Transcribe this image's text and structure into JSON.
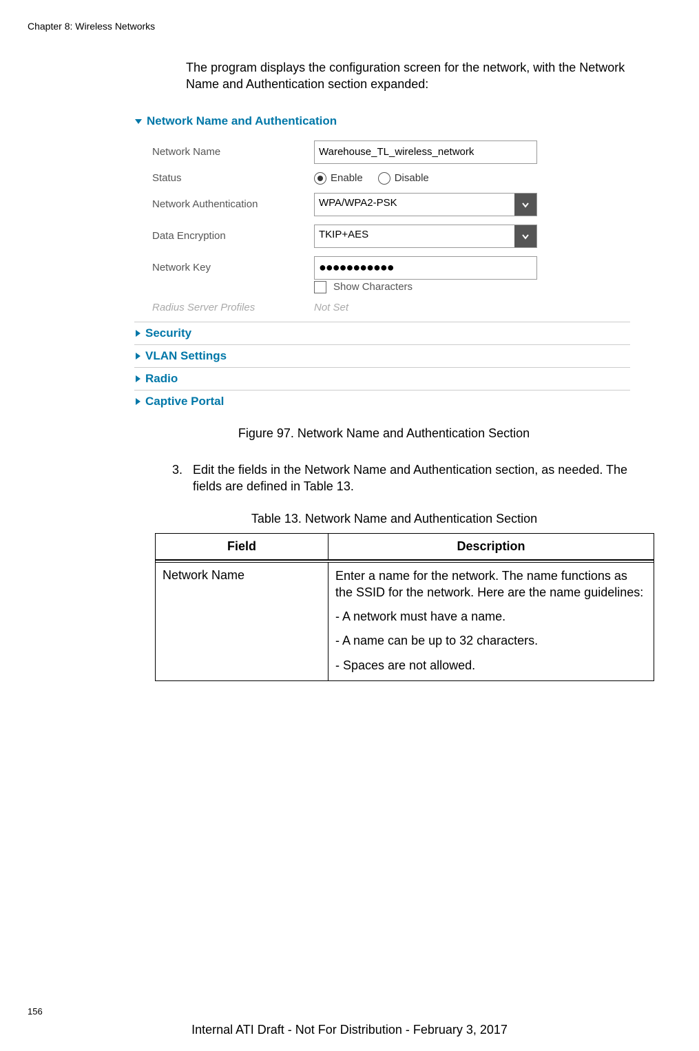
{
  "chapter_header": "Chapter 8: Wireless Networks",
  "intro_text": "The program displays the configuration screen for the network, with the Network Name and Authentication section expanded:",
  "screenshot": {
    "main_section_title": "Network Name and Authentication",
    "rows": {
      "network_name_label": "Network Name",
      "network_name_value": "Warehouse_TL_wireless_network",
      "status_label": "Status",
      "status_enable": "Enable",
      "status_disable": "Disable",
      "net_auth_label": "Network Authentication",
      "net_auth_value": "WPA/WPA2-PSK",
      "data_enc_label": "Data Encryption",
      "data_enc_value": "TKIP+AES",
      "net_key_label": "Network Key",
      "net_key_value": "●●●●●●●●●●●",
      "show_chars_label": "Show Characters",
      "radius_label": "Radius Server Profiles",
      "radius_value": "Not Set"
    },
    "collapsed": [
      "Security",
      "VLAN Settings",
      "Radio",
      "Captive Portal"
    ]
  },
  "figure_caption": "Figure 97. Network Name and Authentication Section",
  "step3_num": "3.",
  "step3_text": "Edit the fields in the Network Name and Authentication section, as needed. The fields are defined in Table 13.",
  "table_caption": "Table 13. Network Name and Authentication Section",
  "table": {
    "header_field": "Field",
    "header_desc": "Description",
    "row1_field": "Network Name",
    "row1_desc_intro": "Enter a name for the network. The name functions as the SSID for the network. Here are the name guidelines:",
    "row1_b1": "- A network must have a name.",
    "row1_b2": "- A name can be up to 32 characters.",
    "row1_b3": "- Spaces are not allowed."
  },
  "page_number": "156",
  "footer_text": "Internal ATI Draft - Not For Distribution - February 3, 2017"
}
